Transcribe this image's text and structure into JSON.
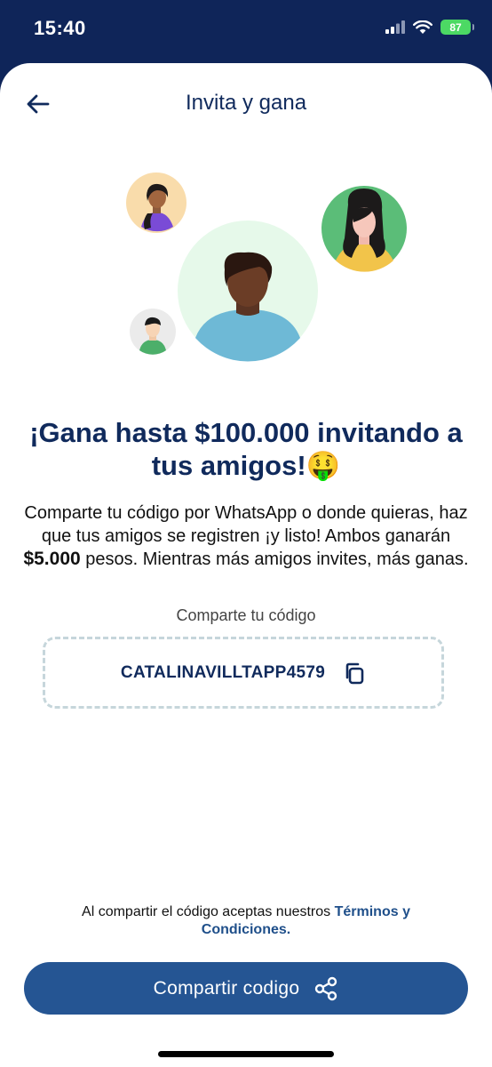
{
  "status_bar": {
    "time": "15:40",
    "battery": "87"
  },
  "header": {
    "title": "Invita y gana",
    "back_icon": "arrow-left-icon"
  },
  "hero": {
    "headline": "¡Gana hasta $100.000 invitando a tus amigos!🤑",
    "description_part1": "Comparte tu código por WhatsApp o donde quieras, haz que tus amigos se registren ¡y listo! Ambos ganarán ",
    "description_amount": "$5.000",
    "description_part2": " pesos. Mientras más amigos invites, más ganas."
  },
  "code_section": {
    "label": "Comparte tu código",
    "code": "CATALINAVILLTAPP4579",
    "copy_icon": "copy-icon"
  },
  "terms": {
    "prefix": "Al compartir el código aceptas nuestros ",
    "link": "Términos y Condiciones."
  },
  "share_button": {
    "label": "Compartir codigo",
    "icon": "share-icon"
  },
  "colors": {
    "primary": "#255593",
    "navy": "#102a5c",
    "header_bg": "#0f2559",
    "dash_border": "#c6d6db"
  }
}
